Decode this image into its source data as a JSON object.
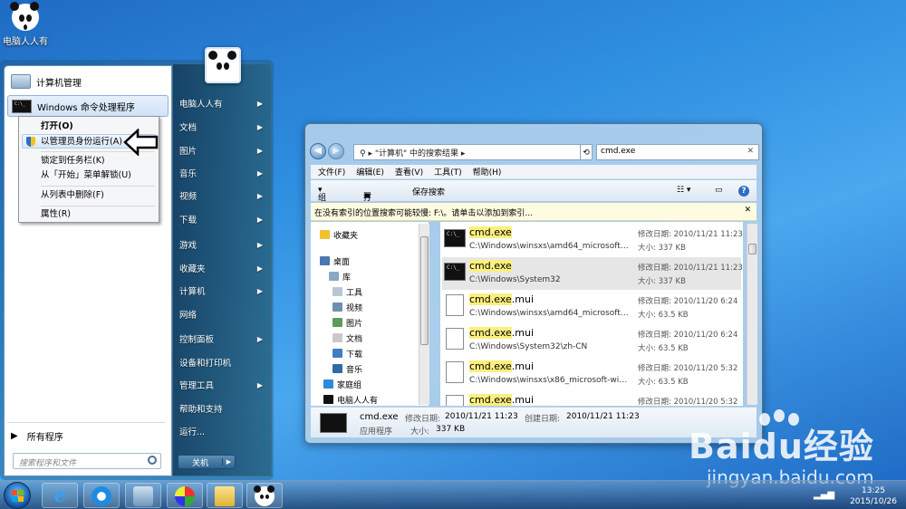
{
  "desktop": {
    "icon_label": "电脑人人有"
  },
  "start_menu": {
    "pinned": [
      {
        "label": "计算机管理"
      },
      {
        "label": "Windows 命令处理程序"
      }
    ],
    "all_programs": "所有程序",
    "search_placeholder": "搜索程序和文件",
    "right_items": [
      "电脑人人有",
      "文档",
      "图片",
      "音乐",
      "视频",
      "下载",
      "游戏",
      "收藏夹",
      "计算机",
      "网络",
      "控制面板",
      "设备和打印机",
      "管理工具",
      "帮助和支持",
      "运行..."
    ],
    "shutdown": "关机"
  },
  "context_menu": {
    "items": [
      "打开(O)",
      "以管理员身份运行(A)",
      "锁定到任务栏(K)",
      "从「开始」菜单解锁(U)",
      "从列表中删除(F)",
      "属性(R)"
    ]
  },
  "explorer": {
    "address": "\"计算机\" 中的搜索结果",
    "search_value": "cmd.exe",
    "menu": [
      "文件(F)",
      "编辑(E)",
      "查看(V)",
      "工具(T)",
      "帮助(H)"
    ],
    "toolbar": {
      "organize": "组织",
      "open": "打开",
      "save_search": "保存搜索"
    },
    "info_bar": "在没有索引的位置搜索可能较慢: F:\\。请单击以添加到索引...",
    "nav": [
      {
        "label": "收藏夹",
        "icon": "star-icon"
      },
      {
        "label": "桌面",
        "icon": "desktop-icon"
      },
      {
        "label": "库",
        "icon": "library-icon"
      },
      {
        "label": "工具",
        "icon": "folder-icon"
      },
      {
        "label": "视频",
        "icon": "video-icon"
      },
      {
        "label": "图片",
        "icon": "picture-icon"
      },
      {
        "label": "文档",
        "icon": "document-icon"
      },
      {
        "label": "下载",
        "icon": "download-icon"
      },
      {
        "label": "音乐",
        "icon": "music-icon"
      },
      {
        "label": "家庭组",
        "icon": "homegroup-icon"
      },
      {
        "label": "电脑人人有",
        "icon": "user-icon"
      }
    ],
    "results": [
      {
        "name_hl": "cmd.exe",
        "name_rest": "",
        "path": "C:\\Windows\\winsxs\\amd64_microsoft-w...",
        "date_label": "修改日期:",
        "date": "2010/11/21 11:23",
        "size_label": "大小:",
        "size": "337 KB",
        "icon": "cmd"
      },
      {
        "name_hl": "cmd.exe",
        "name_rest": "",
        "path": "C:\\Windows\\System32",
        "date_label": "修改日期:",
        "date": "2010/11/21 11:23",
        "size_label": "大小:",
        "size": "337 KB",
        "icon": "cmd"
      },
      {
        "name_hl": "cmd.exe",
        "name_rest": ".mui",
        "path": "C:\\Windows\\winsxs\\amd64_microsoft-w...",
        "date_label": "修改日期:",
        "date": "2010/11/20 6:24",
        "size_label": "大小:",
        "size": "63.5 KB",
        "icon": "doc"
      },
      {
        "name_hl": "cmd.exe",
        "name_rest": ".mui",
        "path": "C:\\Windows\\System32\\zh-CN",
        "date_label": "修改日期:",
        "date": "2010/11/20 6:24",
        "size_label": "大小:",
        "size": "63.5 KB",
        "icon": "doc"
      },
      {
        "name_hl": "cmd.exe",
        "name_rest": ".mui",
        "path": "C:\\Windows\\winsxs\\x86_microsoft-wind...",
        "date_label": "修改日期:",
        "date": "2010/11/20 5:32",
        "size_label": "大小:",
        "size": "63.5 KB",
        "icon": "doc"
      },
      {
        "name_hl": "cmd.exe",
        "name_rest": ".mui",
        "path": "",
        "date_label": "修改日期:",
        "date": "2010/11/20 5:32",
        "size_label": "",
        "size": "",
        "icon": "doc"
      }
    ],
    "details": {
      "name": "cmd.exe",
      "type": "应用程序",
      "modified_label": "修改日期:",
      "modified": "2010/11/21 11:23",
      "size_label": "大小:",
      "size": "337 KB",
      "created_label": "创建日期:",
      "created": "2010/11/21 11:23"
    }
  },
  "taskbar": {
    "time": "13:25",
    "date": "2015/10/26"
  },
  "watermark": {
    "brand": "Baidu经验",
    "url": "jingyan.baidu.com"
  }
}
